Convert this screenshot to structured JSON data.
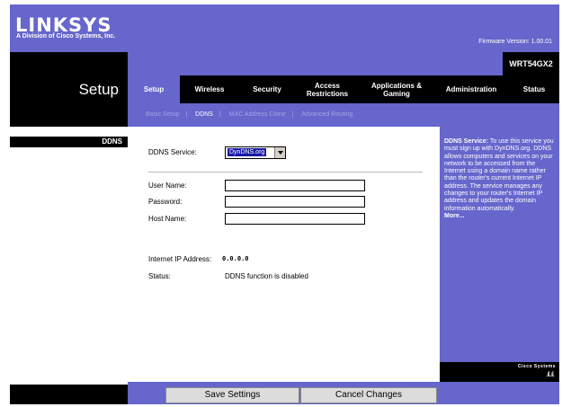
{
  "header": {
    "logo": "LINKSYS",
    "logo_sub": "A Division of Cisco Systems, Inc.",
    "firmware": "Firmware Version: 1.00.01"
  },
  "page_title": "Setup",
  "model": "WRT54GX2",
  "tabs": [
    {
      "label": "Setup",
      "active": true
    },
    {
      "label": "Wireless"
    },
    {
      "label": "Security"
    },
    {
      "label": "Access Restrictions"
    },
    {
      "label": "Applications & Gaming"
    },
    {
      "label": "Administration"
    },
    {
      "label": "Status"
    }
  ],
  "subnav": [
    "Basic Setup",
    "DDNS",
    "MAC Address Clone",
    "Advanced Routing"
  ],
  "subnav_separator": "|",
  "section_label": "DDNS",
  "form": {
    "ddns_service_label": "DDNS Service:",
    "ddns_service_value": "DynDNS.org",
    "user_name_label": "User Name:",
    "password_label": "Password:",
    "host_name_label": "Host Name:",
    "user_name_value": "",
    "password_value": "",
    "host_name_value": "",
    "ip_label": "Internet IP Address:",
    "ip_value": "0.0.0.0",
    "status_label": "Status:",
    "status_value": "DDNS function is disabled"
  },
  "help": {
    "title": "DDNS Service:",
    "body": "To use this service you must sign up with DynDNS.org. DDNS allows computers and services on your network to be accessed from the Internet using a domain name rather than the router's current Internet IP address. The service manages any changes to your router's Internet IP address and updates the domain information automatically.",
    "more": "More..."
  },
  "cisco": {
    "brand": "Cisco Systems"
  },
  "buttons": {
    "save": "Save Settings",
    "cancel": "Cancel Changes"
  },
  "colors": {
    "brand": "#6666cc",
    "dark": "#000000"
  }
}
